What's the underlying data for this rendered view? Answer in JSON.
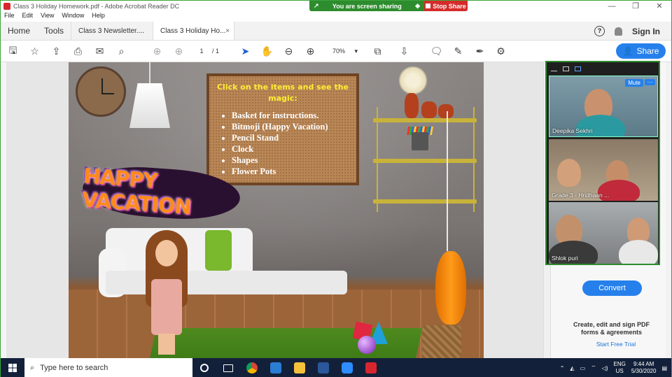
{
  "window": {
    "title": "Class 3 Holiday Homework.pdf - Adobe Acrobat Reader DC",
    "controls": [
      "—",
      "❐",
      "✕"
    ]
  },
  "screen_share": {
    "status": "You are screen sharing",
    "stop_label": "Stop Share"
  },
  "menu": [
    "File",
    "Edit",
    "View",
    "Window",
    "Help"
  ],
  "tabs": {
    "home": "Home",
    "tools": "Tools",
    "docs": [
      {
        "label": "Class 3 Newsletter....",
        "active": false
      },
      {
        "label": "Class 3 Holiday Ho...",
        "active": true
      }
    ],
    "close_glyph": "×",
    "help_glyph": "?",
    "sign_in": "Sign In"
  },
  "toolbar": {
    "page_current": "1",
    "page_total": "/ 1",
    "zoom": "70%",
    "share_label": "Share",
    "icons": [
      "save-icon",
      "star-icon",
      "upload-icon",
      "print-icon",
      "mail-icon",
      "zoom-search-icon",
      "page-up-icon",
      "page-down-icon",
      "select-cursor-icon",
      "hand-icon",
      "zoom-out-icon",
      "zoom-in-icon",
      "fit-page-icon",
      "scroll-mode-icon",
      "comment-icon",
      "highlight-icon",
      "sign-icon",
      "more-tools-icon"
    ]
  },
  "page": {
    "board_title": "Click on the items and see the magic:",
    "board_items": [
      "Basket for instructions.",
      "Bitmoji (Happy Vacation)",
      "Pencil Stand",
      "Clock",
      "Shapes",
      "Flower Pots"
    ],
    "banner": "HAPPY VACATION"
  },
  "video": {
    "participants": [
      "Deepika Sekhri",
      "Grade 3 - Hridhaan ...",
      "Shlok puri"
    ],
    "mute_label": "Mute",
    "more_label": "···"
  },
  "right_pane": {
    "convert_label": "Convert",
    "promo": "Create, edit and sign PDF forms & agreements",
    "link": "Start Free Trial"
  },
  "taskbar": {
    "search_placeholder": "Type here to search",
    "lang_top": "ENG",
    "lang_bottom": "US",
    "time": "9:44 AM",
    "date": "5/30/2020"
  },
  "colors": {
    "accent": "#2680eb",
    "share_green": "#2d8c2d",
    "stop_red": "#d52b2b",
    "board_text": "#ffee33"
  }
}
